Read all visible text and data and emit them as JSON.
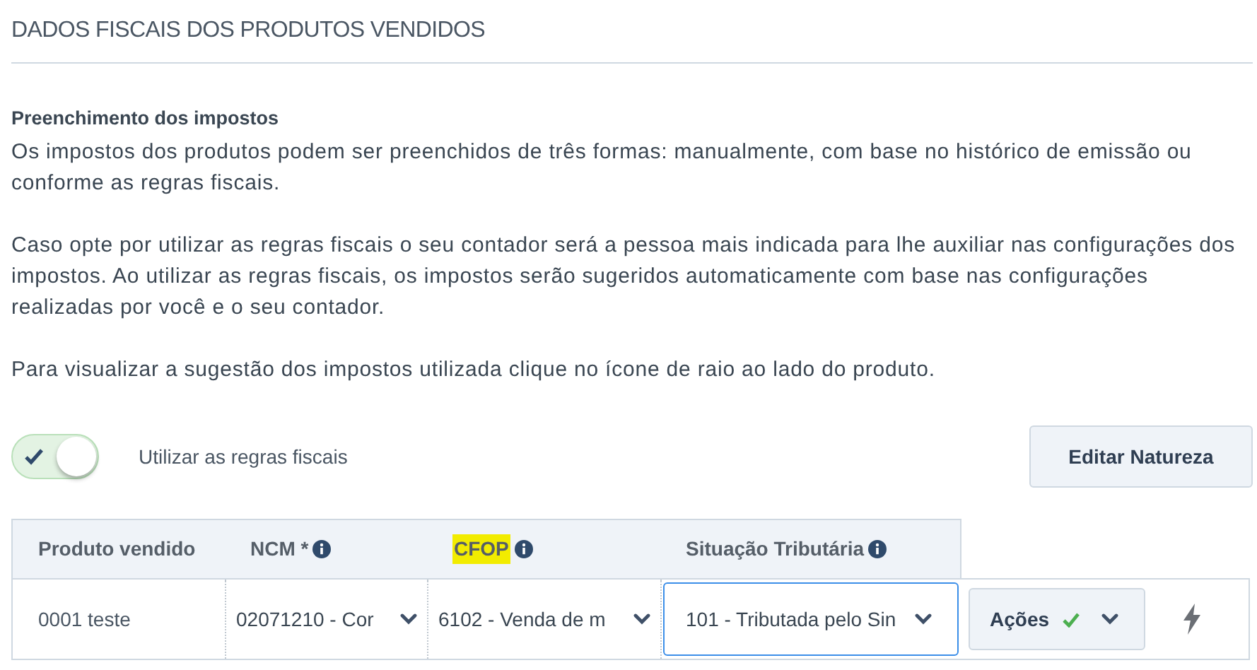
{
  "section_title": "DADOS FISCAIS DOS PRODUTOS VENDIDOS",
  "info": {
    "heading": "Preenchimento dos impostos",
    "paragraphs": [
      "Os impostos dos produtos podem ser preenchidos de três formas: manualmente, com base no histórico de emissão ou conforme as regras fiscais.",
      "Caso opte por utilizar as regras fiscais o seu contador será a pessoa mais indicada para lhe auxiliar nas configurações dos impostos. Ao utilizar as regras fiscais, os impostos serão sugeridos automaticamente com base nas configurações realizadas por você e o seu contador.",
      "Para visualizar a sugestão dos impostos utilizada clique no ícone de raio ao lado do produto."
    ]
  },
  "toggle": {
    "label": "Utilizar as regras fiscais",
    "on": true
  },
  "edit_button": "Editar Natureza",
  "table": {
    "columns": [
      {
        "label": "Produto vendido",
        "info": false,
        "highlighted": false
      },
      {
        "label": "NCM *",
        "info": true,
        "highlighted": false
      },
      {
        "label": "CFOP",
        "info": true,
        "highlighted": true
      },
      {
        "label": "Situação Tributária",
        "info": true,
        "highlighted": false
      }
    ],
    "rows": [
      {
        "cells": [
          {
            "kind": "text",
            "value": "0001 teste"
          },
          {
            "kind": "select",
            "value": "02071210 - Cor",
            "focused": false
          },
          {
            "kind": "select",
            "value": "6102 - Venda de m",
            "focused": false
          },
          {
            "kind": "select",
            "value": "101 - Tributada pelo Sin",
            "focused": true
          }
        ],
        "actions": {
          "label": "Ações",
          "confirmed": true
        }
      }
    ]
  }
}
